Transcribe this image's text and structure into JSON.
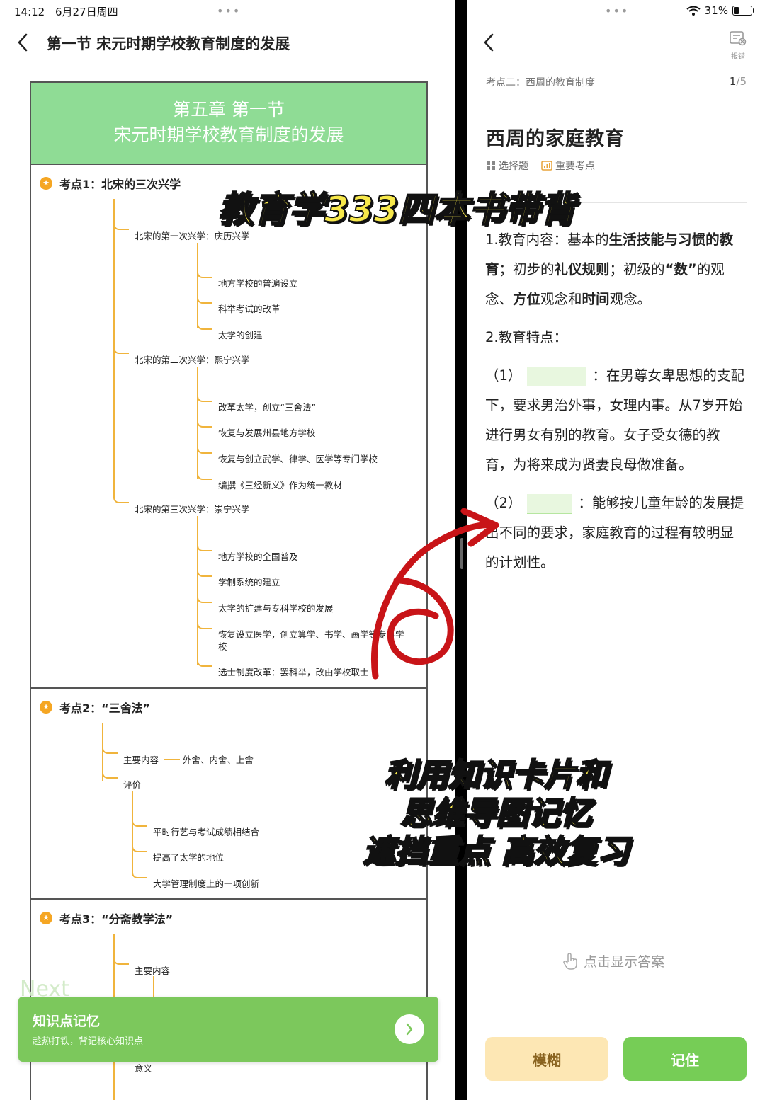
{
  "left": {
    "status": {
      "time": "14:12",
      "date": "6月27日周四"
    },
    "page_title": "第一节 宋元时期学校教育制度的发展",
    "doc_header": {
      "line1": "第五章 第一节",
      "line2": "宋元时期学校教育制度的发展"
    },
    "point1": {
      "title": "考点1：北宋的三次兴学",
      "groups": [
        {
          "label": "北宋的第一次兴学：庆历兴学",
          "items": [
            "地方学校的普遍设立",
            "科举考试的改革",
            "太学的创建"
          ]
        },
        {
          "label": "北宋的第二次兴学：熙宁兴学",
          "items": [
            "改革太学，创立“三舍法”",
            "恢复与发展州县地方学校",
            "恢复与创立武学、律学、医学等专门学校",
            "编撰《三经新义》作为统一教材"
          ]
        },
        {
          "label": "北宋的第三次兴学：崇宁兴学",
          "items": [
            "地方学校的全国普及",
            "学制系统的建立",
            "太学的扩建与专科学校的发展",
            "恢复设立医学，创立算学、书学、画学等专科学",
            "校",
            "选士制度改革：罢科举，改由学校取士"
          ]
        }
      ]
    },
    "point2": {
      "title": "考点2：“三舍法”",
      "main_label": "主要内容",
      "main_value": "外舍、内舍、上舍",
      "eval_label": "评价",
      "eval_items": [
        "平时行艺与考试成绩相结合",
        "提高了太学的地位",
        "大学管理制度上的一项创新"
      ]
    },
    "point3": {
      "title": "考点3：“分斋教学法”",
      "main_label": "主要内容",
      "meaning_label": "意义"
    },
    "next_label": "Next",
    "card": {
      "title": "知识点记忆",
      "subtitle": "趁热打铁，背记核心知识点"
    }
  },
  "right": {
    "status": {
      "battery": "31%",
      "battery_level": 0.31
    },
    "report_label": "报错",
    "topic": "考点二：西周的教育制度",
    "progress_current": "1",
    "progress_total": "/5",
    "question_title": "西周的家庭教育",
    "tags": [
      "选择题",
      "重要考点"
    ],
    "content": {
      "p1": {
        "t1": "1.教育内容：基本的",
        "b1": "生活技能与习惯的教育",
        "t2": "；初步的",
        "b2": "礼仪规则",
        "t3": "；初级的",
        "b3": "“数”",
        "t4": "的观念、",
        "b4": "方位",
        "t5": "观念和",
        "b5": "时间",
        "t6": "观念。"
      },
      "p2": "2.教育特点：",
      "p3": {
        "num": "（1）",
        "rest": "：在男尊女卑思想的支配下，要求男治外事，女理内事。从7岁开始进行男女有别的教育。女子受女德的教育，为将来成为贤妻良母做准备。"
      },
      "p4": {
        "num": "（2）",
        "rest": "：能够按儿童年龄的发展提出不同的要求，家庭教育的过程有较明显的计划性。"
      }
    },
    "show_answer": "点击显示答案",
    "buttons": {
      "fuzzy": "模糊",
      "remember": "记住"
    }
  },
  "overlay": {
    "headline": "教育学333四本书带背",
    "caption_line1": "利用知识卡片和",
    "caption_line2": "思维导图记忆",
    "caption_line3": "遮挡重点 高效复习"
  },
  "colors": {
    "header_green": "#8fdc95",
    "card_green": "#7cc85c",
    "button_green": "#76cd56",
    "button_yellow": "#fde7b4",
    "branch_orange": "#f0b43c",
    "overlay_yellow": "#f7e84a",
    "arrow_red": "#c81418"
  }
}
